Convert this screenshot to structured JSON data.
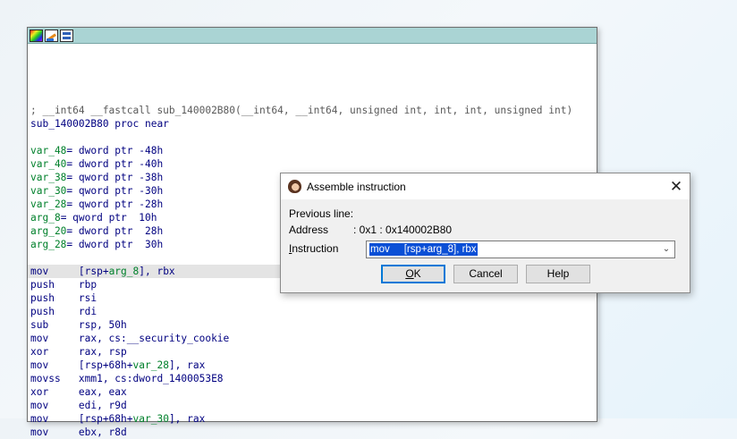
{
  "ida_window": {
    "lines": [
      {
        "parts": [
          {
            "t": "; __int64 __fastcall sub_140002B80(__int64, __int64, unsigned int, int, int, unsigned int)",
            "c": "c-comment"
          }
        ]
      },
      {
        "parts": [
          {
            "t": "sub_140002B80 proc near",
            "c": "c-name"
          }
        ]
      },
      {
        "parts": [
          {
            "t": "var_48",
            "c": "c-var"
          },
          {
            "t": "= dword ptr -48h",
            "c": "c-name"
          }
        ]
      },
      {
        "parts": [
          {
            "t": "var_40",
            "c": "c-var"
          },
          {
            "t": "= dword ptr -40h",
            "c": "c-name"
          }
        ]
      },
      {
        "parts": [
          {
            "t": "var_38",
            "c": "c-var"
          },
          {
            "t": "= qword ptr -38h",
            "c": "c-name"
          }
        ]
      },
      {
        "parts": [
          {
            "t": "var_30",
            "c": "c-var"
          },
          {
            "t": "= qword ptr -30h",
            "c": "c-name"
          }
        ]
      },
      {
        "parts": [
          {
            "t": "var_28",
            "c": "c-var"
          },
          {
            "t": "= qword ptr -28h",
            "c": "c-name"
          }
        ]
      },
      {
        "parts": [
          {
            "t": "arg_8",
            "c": "c-arg"
          },
          {
            "t": "= qword ptr  10h",
            "c": "c-name"
          }
        ]
      },
      {
        "parts": [
          {
            "t": "arg_20",
            "c": "c-arg"
          },
          {
            "t": "= dword ptr  28h",
            "c": "c-name"
          }
        ]
      },
      {
        "parts": [
          {
            "t": "arg_28",
            "c": "c-arg"
          },
          {
            "t": "= dword ptr  30h",
            "c": "c-name"
          }
        ]
      },
      {
        "parts": [
          {
            "t": "mov     [rsp+",
            "c": "c-name"
          },
          {
            "t": "arg_8",
            "c": "c-arg"
          },
          {
            "t": "], rbx",
            "c": "c-name"
          }
        ],
        "highlight": true
      },
      {
        "parts": [
          {
            "t": "push    rbp",
            "c": "c-name"
          }
        ]
      },
      {
        "parts": [
          {
            "t": "push    rsi",
            "c": "c-name"
          }
        ]
      },
      {
        "parts": [
          {
            "t": "push    rdi",
            "c": "c-name"
          }
        ]
      },
      {
        "parts": [
          {
            "t": "sub     rsp, 50h",
            "c": "c-name"
          }
        ]
      },
      {
        "parts": [
          {
            "t": "mov     rax, cs:__security_cookie",
            "c": "c-name"
          }
        ]
      },
      {
        "parts": [
          {
            "t": "xor     rax, rsp",
            "c": "c-name"
          }
        ]
      },
      {
        "parts": [
          {
            "t": "mov     [rsp+68h+",
            "c": "c-name"
          },
          {
            "t": "var_28",
            "c": "c-var"
          },
          {
            "t": "], rax",
            "c": "c-name"
          }
        ]
      },
      {
        "parts": [
          {
            "t": "movss   xmm1, cs:dword_1400053E8",
            "c": "c-name"
          }
        ]
      },
      {
        "parts": [
          {
            "t": "xor     eax, eax",
            "c": "c-name"
          }
        ]
      },
      {
        "parts": [
          {
            "t": "mov     edi, r9d",
            "c": "c-name"
          }
        ]
      },
      {
        "parts": [
          {
            "t": "mov     [rsp+68h+",
            "c": "c-name"
          },
          {
            "t": "var_30",
            "c": "c-var"
          },
          {
            "t": "], rax",
            "c": "c-name"
          }
        ]
      },
      {
        "parts": [
          {
            "t": "mov     ebx, r8d",
            "c": "c-name"
          }
        ]
      }
    ]
  },
  "dialog": {
    "title": "Assemble instruction",
    "close_glyph": "✕",
    "previous_line_label": "Previous line:",
    "address_label": "Address",
    "address_value": ": 0x1 : 0x140002B80",
    "instruction_label": "Instruction",
    "instruction_label_underline": "I",
    "instruction_label_rest": "nstruction",
    "instruction_value": "mov     [rsp+arg_8], rbx",
    "ok_label_underline": "O",
    "ok_label_rest": "K",
    "cancel_label": "Cancel",
    "help_label": "Help"
  }
}
